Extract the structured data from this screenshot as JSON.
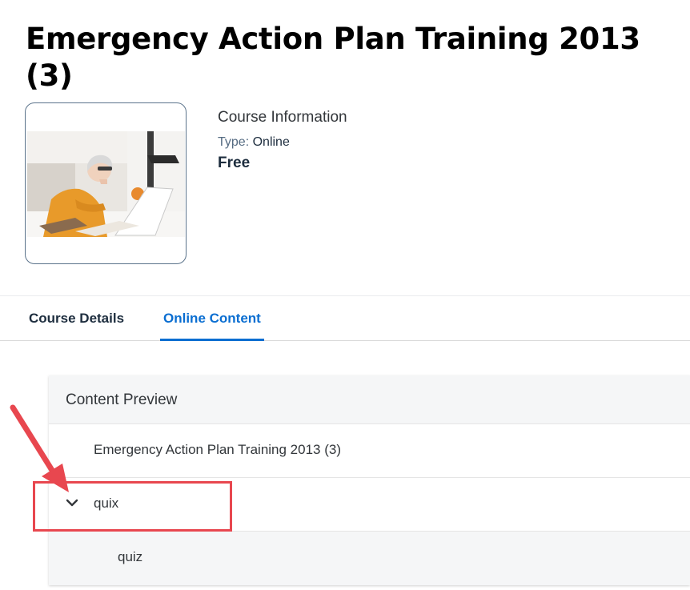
{
  "course": {
    "title": "Emergency Action Plan Training 2013 (3)",
    "info_heading": "Course Information",
    "type_label": "Type:",
    "type_value": "Online",
    "price": "Free"
  },
  "tabs": [
    {
      "label": "Course Details",
      "active": false
    },
    {
      "label": "Online Content",
      "active": true
    }
  ],
  "preview": {
    "title": "Content Preview",
    "items": [
      {
        "label": "Emergency Action Plan Training 2013 (3)"
      },
      {
        "label": "quix",
        "expanded": true,
        "icon": "chevron-down-icon"
      },
      {
        "label": "quiz"
      }
    ]
  },
  "colors": {
    "accent": "#0a6ed1",
    "annotation": "#e8474f"
  }
}
